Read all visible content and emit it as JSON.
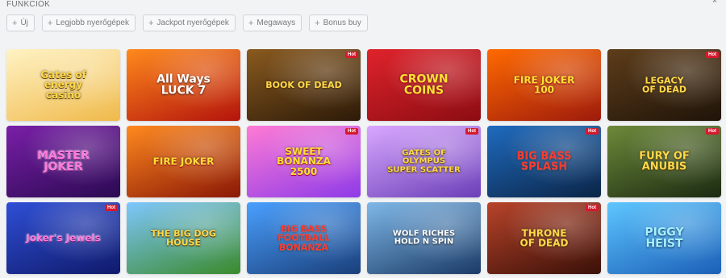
{
  "section": {
    "title": "FUNKCIÓK",
    "collapse_icon": "chevron-up-icon"
  },
  "filters": [
    {
      "label": "Új"
    },
    {
      "label": "Legjobb nyerőgépek"
    },
    {
      "label": "Jackpot nyerőgépek"
    },
    {
      "label": "Megaways"
    },
    {
      "label": "Bonus buy"
    }
  ],
  "games": [
    {
      "title": "Gates of\nenergy\ncasino",
      "badge": "",
      "colors": [
        "#fff3c4",
        "#f0b94a"
      ],
      "style": "t-gold",
      "size": 12
    },
    {
      "title": "All Ways\nLUCK 7",
      "badge": "",
      "colors": [
        "#ff8a1c",
        "#b3140c"
      ],
      "style": "t-white",
      "size": 14
    },
    {
      "title": "BOOK OF DEAD",
      "badge": "Hot",
      "colors": [
        "#8a5a1f",
        "#2c1a08"
      ],
      "style": "t-gold",
      "size": 11
    },
    {
      "title": "CROWN\nCOINS",
      "badge": "",
      "colors": [
        "#e0232c",
        "#8c0d12"
      ],
      "style": "t-yellow",
      "size": 14
    },
    {
      "title": "FIRE JOKER\n100",
      "badge": "",
      "colors": [
        "#ff6a00",
        "#9e1b0c"
      ],
      "style": "t-yellow",
      "size": 12
    },
    {
      "title": "LEGACY\nOF DEAD",
      "badge": "Hot",
      "colors": [
        "#5e3d1a",
        "#1f1409"
      ],
      "style": "t-gold",
      "size": 11
    },
    {
      "title": "MASTER\nJOKER",
      "badge": "",
      "colors": [
        "#7a1fa8",
        "#2b0a52"
      ],
      "style": "t-pink",
      "size": 14
    },
    {
      "title": "FIRE JOKER",
      "badge": "",
      "colors": [
        "#ff8a1f",
        "#8a1706"
      ],
      "style": "t-yellow",
      "size": 12
    },
    {
      "title": "SWEET\nBONANZA\n2500",
      "badge": "Hot",
      "colors": [
        "#ff7bd5",
        "#8e3be8"
      ],
      "style": "t-yellow",
      "size": 12
    },
    {
      "title": "GATES OF\nOLYMPUS\nSUPER SCATTER",
      "badge": "Hot",
      "colors": [
        "#d9a8ff",
        "#6b3fb8"
      ],
      "style": "t-gold",
      "size": 10
    },
    {
      "title": "BIG BASS\nSPLASH",
      "badge": "Hot",
      "colors": [
        "#1f6bbf",
        "#0b2547"
      ],
      "style": "t-red",
      "size": 13
    },
    {
      "title": "FURY OF\nANUBIS",
      "badge": "Hot",
      "colors": [
        "#6e8a3a",
        "#1b2a12"
      ],
      "style": "t-gold",
      "size": 13
    },
    {
      "title": "Joker's Jewels",
      "badge": "Hot",
      "colors": [
        "#2f4fd6",
        "#0f1a6b"
      ],
      "style": "t-pink",
      "size": 12
    },
    {
      "title": "THE BIG DOG\nHOUSE",
      "badge": "",
      "colors": [
        "#7fc7ff",
        "#3a8a2a"
      ],
      "style": "t-gold",
      "size": 11
    },
    {
      "title": "BIG BASS\nFOOTBALL\nBONANZA",
      "badge": "",
      "colors": [
        "#4aa0ff",
        "#1a3f7a"
      ],
      "style": "t-red",
      "size": 11
    },
    {
      "title": "WOLF RICHES\nHOLD N SPIN",
      "badge": "",
      "colors": [
        "#7fb8e8",
        "#1b3a66"
      ],
      "style": "t-white",
      "size": 10
    },
    {
      "title": "THRONE\nOF DEAD",
      "badge": "Hot",
      "colors": [
        "#b8442a",
        "#3a1008"
      ],
      "style": "t-gold",
      "size": 12
    },
    {
      "title": "PIGGY\nHEIST",
      "badge": "",
      "colors": [
        "#5ec7ff",
        "#1b5fb8"
      ],
      "style": "t-cyan",
      "size": 14
    }
  ]
}
